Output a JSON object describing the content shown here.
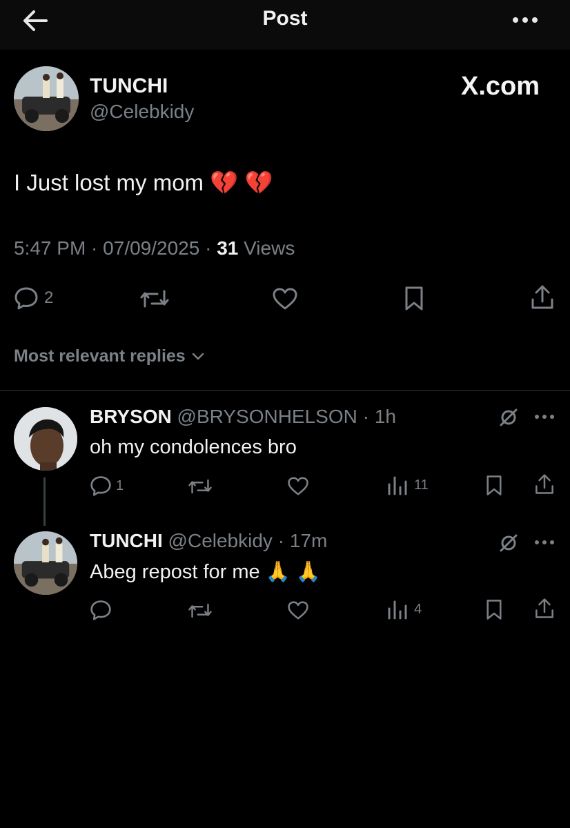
{
  "header": {
    "title": "Post",
    "back_icon": "arrow-left-icon",
    "more_icon": "more-horizontal-icon"
  },
  "post": {
    "author_name": "TUNCHI",
    "author_handle": "@Celebkidy",
    "watermark": "X.com",
    "text": "I Just lost my mom 💔 💔",
    "time": "5:47 PM",
    "date": "07/09/2025",
    "views_count": "31",
    "views_label": "Views",
    "reply_count": "2"
  },
  "replies_sort": {
    "label": "Most relevant replies"
  },
  "replies": [
    {
      "name": "BRYSON",
      "handle": "@BRYSONHELSON",
      "time": "1h",
      "text": "oh my condolences bro",
      "reply_count": "1",
      "views": "11"
    },
    {
      "name": "TUNCHI",
      "handle": "@Celebkidy",
      "time": "17m",
      "text": "Abeg repost for me 🙏 🙏",
      "reply_count": "",
      "views": "4"
    }
  ],
  "colors": {
    "background": "#000000",
    "text": "#e7e9ea",
    "muted": "#7b8187",
    "divider": "#2f3336"
  }
}
